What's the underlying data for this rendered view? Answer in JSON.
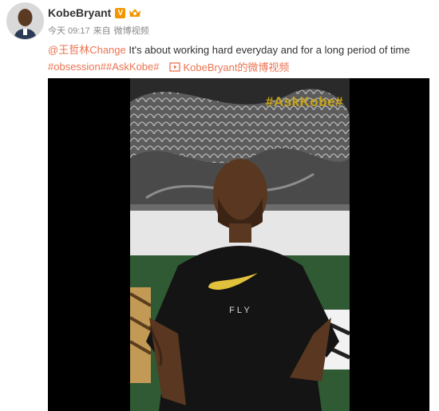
{
  "post": {
    "author": "KobeBryant",
    "verified_badge": "V",
    "time": "今天 09:17",
    "source_prefix": "来自",
    "source": "微博视频",
    "mention": "@王哲林Change",
    "text": " It's about working hard everyday and for a long period of time",
    "hashtags": [
      "#obsession#",
      "#AskKobe#"
    ],
    "video_link": "KobeBryant的微博视频"
  },
  "video": {
    "overlay_tag": "#AskKobe#",
    "shirt_text": "F L Y"
  },
  "colors": {
    "accent": "#eb7350",
    "verified": "#f29500",
    "overlay": "#c9a516"
  },
  "icons": [
    "avatar",
    "verified-badge",
    "member-icon",
    "video-icon",
    "nike-swoosh"
  ]
}
